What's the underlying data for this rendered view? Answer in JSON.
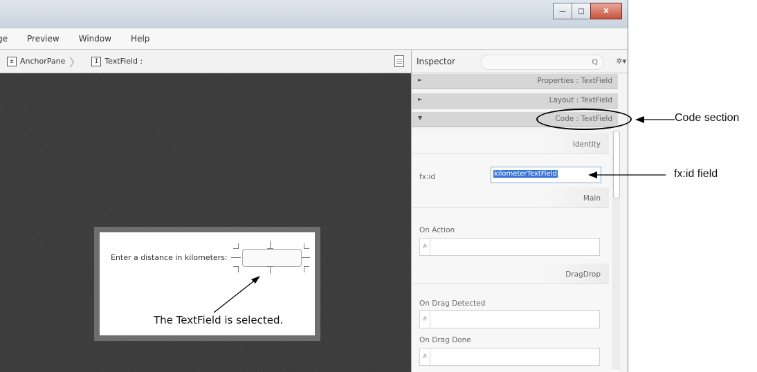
{
  "window": {
    "buttons": {
      "minimize": "—",
      "maximize": "□",
      "close": "X"
    }
  },
  "menubar": {
    "items": [
      "ge",
      "Preview",
      "Window",
      "Help"
    ]
  },
  "breadcrumb": {
    "items": [
      {
        "icon": "anchorpane-icon",
        "glyph": "±",
        "label": "AnchorPane"
      },
      {
        "icon": "textfield-icon",
        "glyph": "I",
        "label": "TextField :"
      }
    ]
  },
  "canvas": {
    "form_label": "Enter a distance in kilometers:",
    "annotation": "The TextField is selected."
  },
  "inspector": {
    "title": "Inspector",
    "search_placeholder": "",
    "search_icon": "Q",
    "gear_icon": "✲▾",
    "sections": [
      {
        "arrow": "►",
        "label": "Properties : TextField"
      },
      {
        "arrow": "►",
        "label": "Layout : TextField"
      },
      {
        "arrow": "▼",
        "label": "Code : TextField"
      }
    ],
    "code": {
      "identity_label": "Identity",
      "fxid_label": "fx:id",
      "fxid_value": "kilometerTextField",
      "main_label": "Main",
      "on_action_label": "On Action",
      "dragdrop_label": "DragDrop",
      "on_drag_detected_label": "On Drag Detected",
      "on_drag_done_label": "On Drag Done",
      "hash": "#"
    }
  },
  "callouts": {
    "code_section": "Code section",
    "fxid_field": "fx:id field"
  }
}
